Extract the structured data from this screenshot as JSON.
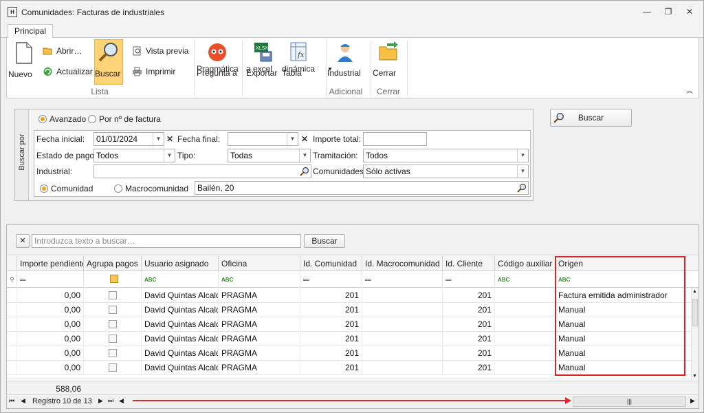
{
  "window": {
    "title": "Comunidades: Facturas de industriales",
    "icon_text": "H",
    "controls": [
      "—",
      "❐",
      "✕"
    ]
  },
  "ribbon": {
    "tab": "Principal",
    "nuevo": "Nuevo",
    "abrir": "Abrir…",
    "actualizar": "Actualizar",
    "buscar": "Buscar",
    "vista_previa": "Vista previa",
    "imprimir": "Imprimir",
    "pregunta_l1": "Pregunta a",
    "pregunta_l2": "Pragmática",
    "exportar_l1": "Exportar",
    "exportar_l2": "a excel",
    "tabla_l1": "Tabla",
    "tabla_l2": "dinámica",
    "industrial": "Industrial",
    "cerrar": "Cerrar",
    "group_lista": "Lista",
    "group_adicional": "Adicional",
    "group_cerrar": "Cerrar"
  },
  "search": {
    "side_label": "Buscar por",
    "mode_avanzado": "Avanzado",
    "mode_factura": "Por nº de factura",
    "fecha_inicial_label": "Fecha inicial:",
    "fecha_inicial_value": "01/01/2024",
    "fecha_final_label": "Fecha final:",
    "fecha_final_value": "",
    "importe_total_label": "Importe total:",
    "importe_total_value": "",
    "estado_pago_label": "Estado de pago:",
    "estado_pago_value": "Todos",
    "tipo_label": "Tipo:",
    "tipo_value": "Todas",
    "tramitacion_label": "Tramitación:",
    "tramitacion_value": "Todos",
    "industrial_label": "Industrial:",
    "industrial_value": "",
    "comunidades_label": "Comunidades:",
    "comunidades_value": "Sólo activas",
    "scope_comunidad": "Comunidad",
    "scope_macro": "Macrocomunidad",
    "community_value": "Bailén, 20",
    "buscar_button": "Buscar"
  },
  "findbar": {
    "placeholder": "Introduzca texto a buscar…",
    "button": "Buscar"
  },
  "grid": {
    "columns": [
      "Importe pendiente",
      "Agrupa pagos",
      "Usuario asignado",
      "Oficina",
      "Id. Comunidad",
      "Id. Macrocomunidad",
      "Id. Cliente",
      "Código auxiliar",
      "Origen"
    ],
    "rows": [
      {
        "importe": "0,00",
        "usuario": "David Quintas Alcalde",
        "oficina": "PRAGMA",
        "id_comunidad": "201",
        "id_macro": "",
        "id_cliente": "201",
        "codigo": "",
        "origen": "Factura emitida administrador"
      },
      {
        "importe": "0,00",
        "usuario": "David Quintas Alcalde",
        "oficina": "PRAGMA",
        "id_comunidad": "201",
        "id_macro": "",
        "id_cliente": "201",
        "codigo": "",
        "origen": "Manual"
      },
      {
        "importe": "0,00",
        "usuario": "David Quintas Alcalde",
        "oficina": "PRAGMA",
        "id_comunidad": "201",
        "id_macro": "",
        "id_cliente": "201",
        "codigo": "",
        "origen": "Manual"
      },
      {
        "importe": "0,00",
        "usuario": "David Quintas Alcalde",
        "oficina": "PRAGMA",
        "id_comunidad": "201",
        "id_macro": "",
        "id_cliente": "201",
        "codigo": "",
        "origen": "Manual"
      },
      {
        "importe": "0,00",
        "usuario": "David Quintas Alcalde",
        "oficina": "PRAGMA",
        "id_comunidad": "201",
        "id_macro": "",
        "id_cliente": "201",
        "codigo": "",
        "origen": "Manual"
      },
      {
        "importe": "0,00",
        "usuario": "David Quintas Alcalde",
        "oficina": "PRAGMA",
        "id_comunidad": "201",
        "id_macro": "",
        "id_cliente": "201",
        "codigo": "",
        "origen": "Manual"
      }
    ],
    "total": "588,06",
    "record_text": "Registro 10 de 13"
  },
  "colors": {
    "accent": "#f0a30a",
    "highlight": "#d9232b",
    "active_button": "#fcd477"
  }
}
